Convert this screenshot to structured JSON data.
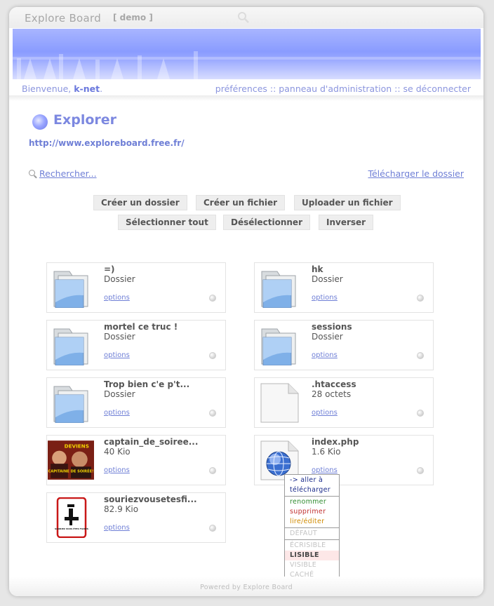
{
  "header": {
    "app_title": "Explore Board",
    "tag": "[ demo ]"
  },
  "userbar": {
    "welcome_prefix": "Bienvenue, ",
    "username": "k-net",
    "welcome_suffix": ".",
    "links": [
      "préférences",
      "panneau d'administration",
      "se déconnecter"
    ],
    "separator": " :: "
  },
  "page": {
    "title": "Explorer",
    "url": "http://www.exploreboard.free.fr/",
    "search_link": "Rechercher...",
    "download_link": "Télécharger le dossier"
  },
  "actions": {
    "row1": [
      "Créer un dossier",
      "Créer un fichier",
      "Uploader un fichier"
    ],
    "row2": [
      "Sélectionner tout",
      "Désélectionner",
      "Inverser"
    ]
  },
  "files": [
    {
      "name": "=)",
      "meta": "Dossier",
      "kind": "folder",
      "options": "options"
    },
    {
      "name": "hk",
      "meta": "Dossier",
      "kind": "folder",
      "options": "options"
    },
    {
      "name": "mortel ce truc !",
      "meta": "Dossier",
      "kind": "folder",
      "options": "options"
    },
    {
      "name": "sessions",
      "meta": "Dossier",
      "kind": "folder",
      "options": "options"
    },
    {
      "name": "Trop bien c'e p't...",
      "meta": "Dossier",
      "kind": "folder",
      "options": "options"
    },
    {
      "name": ".htaccess",
      "meta": "28 octets",
      "kind": "file",
      "options": "options"
    },
    {
      "name": "captain_de_soiree...",
      "meta": "40 Kio",
      "kind": "photo",
      "options": "options",
      "thumb_text": [
        "DEVIENS",
        "CAPITAINE DE SOIRÉE!"
      ]
    },
    {
      "name": "index.php",
      "meta": "1.6 Kio",
      "kind": "php",
      "options": "options"
    },
    {
      "name": "souriezvousetesfi...",
      "meta": "82.9 Kio",
      "kind": "logo",
      "options": "options",
      "thumb_text": [
        "SOURIEZ VOUS ÊTES FILMÉS"
      ]
    }
  ],
  "context_menu": {
    "nav": [
      "-> aller à",
      "télécharger"
    ],
    "edit": [
      "renommer",
      "supprimer",
      "lire/éditer"
    ],
    "default": "DÉFAUT",
    "perms": [
      "ÉCRISIBLE",
      "LISIBLE",
      "VISIBLE",
      "CACHÉ"
    ],
    "selected_perm": "LISIBLE"
  },
  "footer": {
    "text": "Powered by Explore Board"
  },
  "colors": {
    "accent": "#7c88e0",
    "link": "#6f7fd6",
    "banner": "#8a9cff"
  },
  "icons": {
    "folder": "folder-icon",
    "file": "file-icon",
    "php": "globe-icon",
    "search": "search-icon",
    "orb": "orb-icon"
  }
}
